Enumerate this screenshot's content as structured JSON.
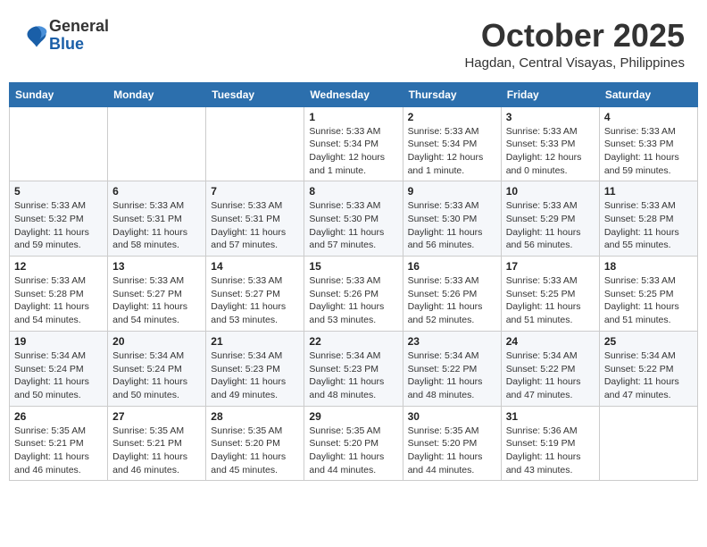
{
  "logo": {
    "general": "General",
    "blue": "Blue"
  },
  "header": {
    "month": "October 2025",
    "location": "Hagdan, Central Visayas, Philippines"
  },
  "weekdays": [
    "Sunday",
    "Monday",
    "Tuesday",
    "Wednesday",
    "Thursday",
    "Friday",
    "Saturday"
  ],
  "weeks": [
    [
      null,
      null,
      null,
      {
        "day": "1",
        "sunrise": "Sunrise: 5:33 AM",
        "sunset": "Sunset: 5:34 PM",
        "daylight": "Daylight: 12 hours and 1 minute."
      },
      {
        "day": "2",
        "sunrise": "Sunrise: 5:33 AM",
        "sunset": "Sunset: 5:34 PM",
        "daylight": "Daylight: 12 hours and 1 minute."
      },
      {
        "day": "3",
        "sunrise": "Sunrise: 5:33 AM",
        "sunset": "Sunset: 5:33 PM",
        "daylight": "Daylight: 12 hours and 0 minutes."
      },
      {
        "day": "4",
        "sunrise": "Sunrise: 5:33 AM",
        "sunset": "Sunset: 5:33 PM",
        "daylight": "Daylight: 11 hours and 59 minutes."
      }
    ],
    [
      {
        "day": "5",
        "sunrise": "Sunrise: 5:33 AM",
        "sunset": "Sunset: 5:32 PM",
        "daylight": "Daylight: 11 hours and 59 minutes."
      },
      {
        "day": "6",
        "sunrise": "Sunrise: 5:33 AM",
        "sunset": "Sunset: 5:31 PM",
        "daylight": "Daylight: 11 hours and 58 minutes."
      },
      {
        "day": "7",
        "sunrise": "Sunrise: 5:33 AM",
        "sunset": "Sunset: 5:31 PM",
        "daylight": "Daylight: 11 hours and 57 minutes."
      },
      {
        "day": "8",
        "sunrise": "Sunrise: 5:33 AM",
        "sunset": "Sunset: 5:30 PM",
        "daylight": "Daylight: 11 hours and 57 minutes."
      },
      {
        "day": "9",
        "sunrise": "Sunrise: 5:33 AM",
        "sunset": "Sunset: 5:30 PM",
        "daylight": "Daylight: 11 hours and 56 minutes."
      },
      {
        "day": "10",
        "sunrise": "Sunrise: 5:33 AM",
        "sunset": "Sunset: 5:29 PM",
        "daylight": "Daylight: 11 hours and 56 minutes."
      },
      {
        "day": "11",
        "sunrise": "Sunrise: 5:33 AM",
        "sunset": "Sunset: 5:28 PM",
        "daylight": "Daylight: 11 hours and 55 minutes."
      }
    ],
    [
      {
        "day": "12",
        "sunrise": "Sunrise: 5:33 AM",
        "sunset": "Sunset: 5:28 PM",
        "daylight": "Daylight: 11 hours and 54 minutes."
      },
      {
        "day": "13",
        "sunrise": "Sunrise: 5:33 AM",
        "sunset": "Sunset: 5:27 PM",
        "daylight": "Daylight: 11 hours and 54 minutes."
      },
      {
        "day": "14",
        "sunrise": "Sunrise: 5:33 AM",
        "sunset": "Sunset: 5:27 PM",
        "daylight": "Daylight: 11 hours and 53 minutes."
      },
      {
        "day": "15",
        "sunrise": "Sunrise: 5:33 AM",
        "sunset": "Sunset: 5:26 PM",
        "daylight": "Daylight: 11 hours and 53 minutes."
      },
      {
        "day": "16",
        "sunrise": "Sunrise: 5:33 AM",
        "sunset": "Sunset: 5:26 PM",
        "daylight": "Daylight: 11 hours and 52 minutes."
      },
      {
        "day": "17",
        "sunrise": "Sunrise: 5:33 AM",
        "sunset": "Sunset: 5:25 PM",
        "daylight": "Daylight: 11 hours and 51 minutes."
      },
      {
        "day": "18",
        "sunrise": "Sunrise: 5:33 AM",
        "sunset": "Sunset: 5:25 PM",
        "daylight": "Daylight: 11 hours and 51 minutes."
      }
    ],
    [
      {
        "day": "19",
        "sunrise": "Sunrise: 5:34 AM",
        "sunset": "Sunset: 5:24 PM",
        "daylight": "Daylight: 11 hours and 50 minutes."
      },
      {
        "day": "20",
        "sunrise": "Sunrise: 5:34 AM",
        "sunset": "Sunset: 5:24 PM",
        "daylight": "Daylight: 11 hours and 50 minutes."
      },
      {
        "day": "21",
        "sunrise": "Sunrise: 5:34 AM",
        "sunset": "Sunset: 5:23 PM",
        "daylight": "Daylight: 11 hours and 49 minutes."
      },
      {
        "day": "22",
        "sunrise": "Sunrise: 5:34 AM",
        "sunset": "Sunset: 5:23 PM",
        "daylight": "Daylight: 11 hours and 48 minutes."
      },
      {
        "day": "23",
        "sunrise": "Sunrise: 5:34 AM",
        "sunset": "Sunset: 5:22 PM",
        "daylight": "Daylight: 11 hours and 48 minutes."
      },
      {
        "day": "24",
        "sunrise": "Sunrise: 5:34 AM",
        "sunset": "Sunset: 5:22 PM",
        "daylight": "Daylight: 11 hours and 47 minutes."
      },
      {
        "day": "25",
        "sunrise": "Sunrise: 5:34 AM",
        "sunset": "Sunset: 5:22 PM",
        "daylight": "Daylight: 11 hours and 47 minutes."
      }
    ],
    [
      {
        "day": "26",
        "sunrise": "Sunrise: 5:35 AM",
        "sunset": "Sunset: 5:21 PM",
        "daylight": "Daylight: 11 hours and 46 minutes."
      },
      {
        "day": "27",
        "sunrise": "Sunrise: 5:35 AM",
        "sunset": "Sunset: 5:21 PM",
        "daylight": "Daylight: 11 hours and 46 minutes."
      },
      {
        "day": "28",
        "sunrise": "Sunrise: 5:35 AM",
        "sunset": "Sunset: 5:20 PM",
        "daylight": "Daylight: 11 hours and 45 minutes."
      },
      {
        "day": "29",
        "sunrise": "Sunrise: 5:35 AM",
        "sunset": "Sunset: 5:20 PM",
        "daylight": "Daylight: 11 hours and 44 minutes."
      },
      {
        "day": "30",
        "sunrise": "Sunrise: 5:35 AM",
        "sunset": "Sunset: 5:20 PM",
        "daylight": "Daylight: 11 hours and 44 minutes."
      },
      {
        "day": "31",
        "sunrise": "Sunrise: 5:36 AM",
        "sunset": "Sunset: 5:19 PM",
        "daylight": "Daylight: 11 hours and 43 minutes."
      },
      null
    ]
  ]
}
